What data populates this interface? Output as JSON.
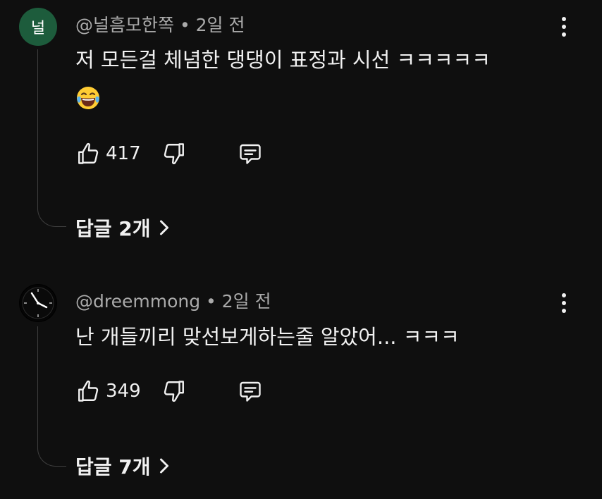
{
  "comments": [
    {
      "avatar_text": "널",
      "author": "@널흠모한쪽",
      "time": "2일 전",
      "text": "저 모든걸 체념한 댕댕이 표정과 시선 ㅋㅋㅋㅋㅋ",
      "likes": "417",
      "replies_label": "답글 2개",
      "avatar_color": "#1d5c3c"
    },
    {
      "author": "@dreemmong",
      "time": "2일 전",
      "text": "난 개들끼리 맞선보게하는줄 알았어... ㅋㅋㅋ",
      "likes": "349",
      "replies_label": "답글 7개"
    }
  ],
  "separator": " • ",
  "icons": {
    "like": "thumbs-up-icon",
    "dislike": "thumbs-down-icon",
    "reply": "comment-icon",
    "more": "more-vert-icon",
    "emoji": "laughing-tears-emoji",
    "chevron": "chevron-right-icon"
  },
  "colors": {
    "background": "#0f0f0f",
    "text": "#f1f1f1",
    "meta": "#aaaaaa"
  }
}
